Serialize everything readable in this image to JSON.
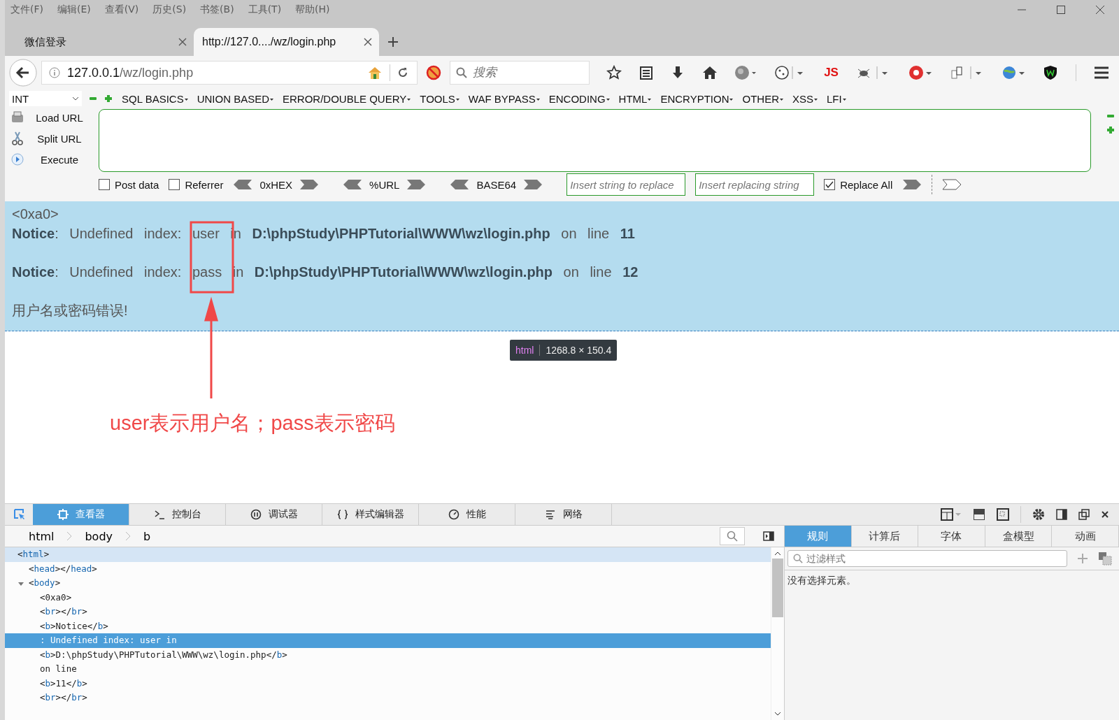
{
  "menu": [
    "文件(F)",
    "编辑(E)",
    "查看(V)",
    "历史(S)",
    "书签(B)",
    "工具(T)",
    "帮助(H)"
  ],
  "tabs": [
    {
      "label": "微信登录",
      "selected": false
    },
    {
      "label": "http://127.0..../wz/login.php",
      "selected": true
    }
  ],
  "address": {
    "host": "127.0.0.1",
    "path": "/wz/login.php"
  },
  "search": {
    "placeholder": "搜索"
  },
  "toolbar_js": "JS",
  "hackbar": {
    "select": "INT",
    "menus": [
      "SQL BASICS",
      "UNION BASED",
      "ERROR/DOUBLE QUERY",
      "TOOLS",
      "WAF BYPASS",
      "ENCODING",
      "HTML",
      "ENCRYPTION",
      "OTHER",
      "XSS",
      "LFI"
    ],
    "actions": [
      {
        "label": "Load URL",
        "kind": "load"
      },
      {
        "label": "Split URL",
        "kind": "split"
      },
      {
        "label": "Execute",
        "kind": "execute"
      }
    ],
    "checkboxes": [
      {
        "label": "Post data",
        "checked": false
      },
      {
        "label": "Referrer",
        "checked": false
      }
    ],
    "encoders": [
      "0xHEX",
      "%URL",
      "BASE64"
    ],
    "replace_from": {
      "placeholder": "Insert string to replace"
    },
    "replace_to": {
      "placeholder": "Insert replacing string"
    },
    "replace_all": {
      "label": "Replace All",
      "checked": true
    }
  },
  "page": {
    "lines": [
      "<0xa0>",
      "**Notice**: Undefined index: user in **D:\\phpStudy\\PHPTutorial\\WWW\\wz\\login.php** on line **11**",
      "**Notice**: Undefined index: pass in **D:\\phpStudy\\PHPTutorial\\WWW\\wz\\login.php** on line **12**",
      "用户名或密码错误!"
    ],
    "annotation": "user表示用户名；pass表示密码",
    "tooltip": {
      "tag": "html",
      "size": "1268.8 × 150.4"
    }
  },
  "devtools": {
    "tabs": [
      {
        "label": "查看器",
        "selected": true
      },
      {
        "label": "控制台",
        "selected": false
      },
      {
        "label": "调试器",
        "selected": false
      },
      {
        "label": "样式编辑器",
        "selected": false
      },
      {
        "label": "性能",
        "selected": false
      },
      {
        "label": "网络",
        "selected": false
      }
    ],
    "breadcrumbs": [
      "html",
      "body",
      "b"
    ],
    "tree": [
      {
        "kind": "element",
        "text": "<html>",
        "hovered": true,
        "selected": false,
        "children": [
          {
            "kind": "element",
            "text": "<head></head>",
            "hovered": false,
            "selected": false
          },
          {
            "kind": "element",
            "text": "<body>",
            "expanded": true,
            "hovered": false,
            "selected": false,
            "children": [
              {
                "kind": "text",
                "text": "<0xa0>",
                "hovered": false,
                "selected": false
              },
              {
                "kind": "element",
                "text": "<br></br>",
                "hovered": false,
                "selected": false
              },
              {
                "kind": "element",
                "text": "<b>Notice</b>",
                "hovered": false,
                "selected": false
              },
              {
                "kind": "text",
                "text": ": Undefined index: user in",
                "hovered": false,
                "selected": true
              },
              {
                "kind": "element",
                "text": "<b>D:\\phpStudy\\PHPTutorial\\WWW\\wz\\login.php</b>",
                "hovered": false,
                "selected": false
              },
              {
                "kind": "text",
                "text": "on line",
                "hovered": false,
                "selected": false
              },
              {
                "kind": "element",
                "text": "<b>11</b>",
                "hovered": false,
                "selected": false
              },
              {
                "kind": "element",
                "text": "<br></br>",
                "hovered": false,
                "selected": false
              }
            ]
          }
        ]
      }
    ],
    "side_tabs": [
      {
        "label": "规则",
        "selected": true
      },
      {
        "label": "计算后",
        "selected": false
      },
      {
        "label": "字体",
        "selected": false
      },
      {
        "label": "盒模型",
        "selected": false
      },
      {
        "label": "动画",
        "selected": false
      }
    ],
    "filter": {
      "placeholder": "过滤样式"
    },
    "empty": "没有选择元素。"
  }
}
